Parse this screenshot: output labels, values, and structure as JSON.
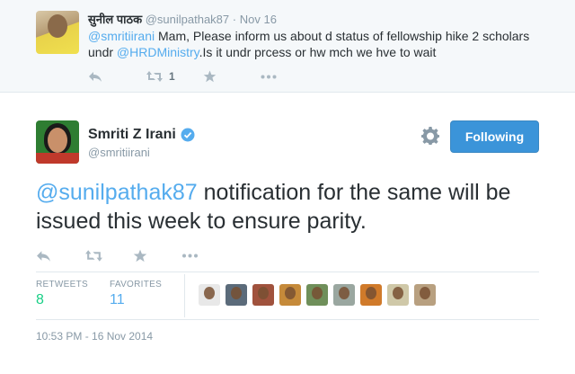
{
  "reply": {
    "name": "सुनील पाठक",
    "handle": "@sunilpathak87",
    "dot": "·",
    "time": "Nov 16",
    "mention1": "@smritiirani",
    "text1": " Mam, Please inform us about d status of fellowship hike 2 scholars undr ",
    "mention2": "@HRDMinistry",
    "text2": ".Is it undr prcess or hw mch we hve to wait",
    "retweet_count": "1",
    "icons": [
      "reply-icon",
      "retweet-icon",
      "favorite-icon",
      "more-icon"
    ]
  },
  "tweet": {
    "author_name": "Smriti Z Irani",
    "author_handle": "@smritiirani",
    "follow_label": "Following",
    "mention": "@sunilpathak87",
    "text": " notification for the same will be issued this week to ensure parity.",
    "retweets_label": "RETWEETS",
    "retweets_count": "8",
    "favorites_label": "FAVORITES",
    "favorites_count": "11",
    "timestamp": "10:53 PM - 16 Nov 2014",
    "accent": "#55acee",
    "button_color": "#3b94d9"
  },
  "favoriters": [
    {
      "bg": "#e8e8e8"
    },
    {
      "bg": "#5b6b7a"
    },
    {
      "bg": "#a0523d"
    },
    {
      "bg": "#c58a3a"
    },
    {
      "bg": "#6f8f5a"
    },
    {
      "bg": "#9aa7a0"
    },
    {
      "bg": "#d07a2a"
    },
    {
      "bg": "#cfc8a8"
    },
    {
      "bg": "#b8a080"
    }
  ]
}
